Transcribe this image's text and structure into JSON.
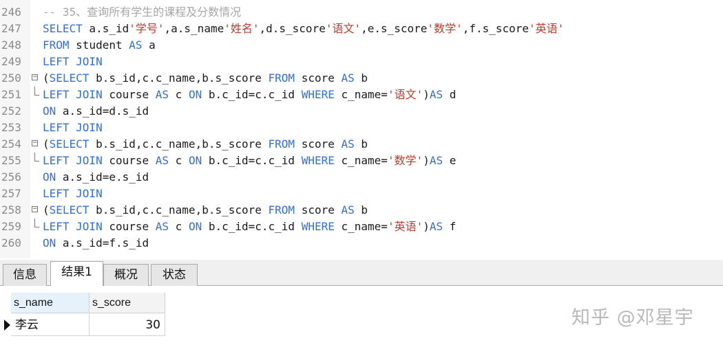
{
  "editor": {
    "lines": [
      {
        "num": "246",
        "fold": "",
        "segments": [
          {
            "t": "-- 35、查询所有学生的课程及分数情况",
            "c": "cmt"
          }
        ]
      },
      {
        "num": "247",
        "fold": "",
        "segments": [
          {
            "t": "SELECT",
            "c": "kw"
          },
          {
            "t": " a.s_id",
            "c": "txt"
          },
          {
            "t": "'学号'",
            "c": "str"
          },
          {
            "t": ",a.s_name",
            "c": "txt"
          },
          {
            "t": "'姓名'",
            "c": "str"
          },
          {
            "t": ",d.s_score",
            "c": "txt"
          },
          {
            "t": "'语文'",
            "c": "str"
          },
          {
            "t": ",e.s_score",
            "c": "txt"
          },
          {
            "t": "'数学'",
            "c": "str"
          },
          {
            "t": ",f.s_score",
            "c": "txt"
          },
          {
            "t": "'英语'",
            "c": "str"
          }
        ]
      },
      {
        "num": "248",
        "fold": "",
        "segments": [
          {
            "t": "FROM",
            "c": "kw"
          },
          {
            "t": " student ",
            "c": "txt"
          },
          {
            "t": "AS",
            "c": "kw"
          },
          {
            "t": " a",
            "c": "txt"
          }
        ]
      },
      {
        "num": "249",
        "fold": "",
        "segments": [
          {
            "t": "LEFT JOIN",
            "c": "kw"
          }
        ]
      },
      {
        "num": "250",
        "fold": "start",
        "segments": [
          {
            "t": "(",
            "c": "txt"
          },
          {
            "t": "SELECT",
            "c": "kw"
          },
          {
            "t": " b.s_id,c.c_name,b.s_score ",
            "c": "txt"
          },
          {
            "t": "FROM",
            "c": "kw"
          },
          {
            "t": " score ",
            "c": "txt"
          },
          {
            "t": "AS",
            "c": "kw"
          },
          {
            "t": " b",
            "c": "txt"
          }
        ]
      },
      {
        "num": "251",
        "fold": "end",
        "segments": [
          {
            "t": "LEFT JOIN",
            "c": "kw"
          },
          {
            "t": " course ",
            "c": "txt"
          },
          {
            "t": "AS",
            "c": "kw"
          },
          {
            "t": " c ",
            "c": "txt"
          },
          {
            "t": "ON",
            "c": "kw"
          },
          {
            "t": " b.c_id=c.c_id ",
            "c": "txt"
          },
          {
            "t": "WHERE",
            "c": "kw"
          },
          {
            "t": " c_name=",
            "c": "txt"
          },
          {
            "t": "'语文'",
            "c": "str"
          },
          {
            "t": ")",
            "c": "txt"
          },
          {
            "t": "AS",
            "c": "kw"
          },
          {
            "t": " d",
            "c": "txt"
          }
        ]
      },
      {
        "num": "252",
        "fold": "",
        "segments": [
          {
            "t": "ON",
            "c": "kw"
          },
          {
            "t": " a.s_id=d.s_id",
            "c": "txt"
          }
        ]
      },
      {
        "num": "253",
        "fold": "",
        "segments": [
          {
            "t": "LEFT JOIN",
            "c": "kw"
          }
        ]
      },
      {
        "num": "254",
        "fold": "start",
        "segments": [
          {
            "t": "(",
            "c": "txt"
          },
          {
            "t": "SELECT",
            "c": "kw"
          },
          {
            "t": " b.s_id,c.c_name,b.s_score ",
            "c": "txt"
          },
          {
            "t": "FROM",
            "c": "kw"
          },
          {
            "t": " score ",
            "c": "txt"
          },
          {
            "t": "AS",
            "c": "kw"
          },
          {
            "t": " b",
            "c": "txt"
          }
        ]
      },
      {
        "num": "255",
        "fold": "end",
        "segments": [
          {
            "t": "LEFT JOIN",
            "c": "kw"
          },
          {
            "t": " course ",
            "c": "txt"
          },
          {
            "t": "AS",
            "c": "kw"
          },
          {
            "t": " c ",
            "c": "txt"
          },
          {
            "t": "ON",
            "c": "kw"
          },
          {
            "t": " b.c_id=c.c_id ",
            "c": "txt"
          },
          {
            "t": "WHERE",
            "c": "kw"
          },
          {
            "t": " c_name=",
            "c": "txt"
          },
          {
            "t": "'数学'",
            "c": "str"
          },
          {
            "t": ")",
            "c": "txt"
          },
          {
            "t": "AS",
            "c": "kw"
          },
          {
            "t": " e",
            "c": "txt"
          }
        ]
      },
      {
        "num": "256",
        "fold": "",
        "segments": [
          {
            "t": "ON",
            "c": "kw"
          },
          {
            "t": " a.s_id=e.s_id",
            "c": "txt"
          }
        ]
      },
      {
        "num": "257",
        "fold": "",
        "segments": [
          {
            "t": "LEFT JOIN",
            "c": "kw"
          }
        ]
      },
      {
        "num": "258",
        "fold": "start",
        "segments": [
          {
            "t": "(",
            "c": "txt"
          },
          {
            "t": "SELECT",
            "c": "kw"
          },
          {
            "t": " b.s_id,c.c_name,b.s_score ",
            "c": "txt"
          },
          {
            "t": "FROM",
            "c": "kw"
          },
          {
            "t": " score ",
            "c": "txt"
          },
          {
            "t": "AS",
            "c": "kw"
          },
          {
            "t": " b",
            "c": "txt"
          }
        ]
      },
      {
        "num": "259",
        "fold": "end",
        "segments": [
          {
            "t": "LEFT JOIN",
            "c": "kw"
          },
          {
            "t": " course ",
            "c": "txt"
          },
          {
            "t": "AS",
            "c": "kw"
          },
          {
            "t": " c ",
            "c": "txt"
          },
          {
            "t": "ON",
            "c": "kw"
          },
          {
            "t": " b.c_id=c.c_id ",
            "c": "txt"
          },
          {
            "t": "WHERE",
            "c": "kw"
          },
          {
            "t": " c_name=",
            "c": "txt"
          },
          {
            "t": "'英语'",
            "c": "str"
          },
          {
            "t": ")",
            "c": "txt"
          },
          {
            "t": "AS",
            "c": "kw"
          },
          {
            "t": " f",
            "c": "txt"
          }
        ]
      },
      {
        "num": "260",
        "fold": "",
        "segments": [
          {
            "t": "ON",
            "c": "kw"
          },
          {
            "t": " a.s_id=f.s_id",
            "c": "txt"
          }
        ]
      }
    ]
  },
  "tabs": [
    {
      "label": "信息",
      "active": false
    },
    {
      "label": "结果1",
      "active": true
    },
    {
      "label": "概况",
      "active": false
    },
    {
      "label": "状态",
      "active": false
    }
  ],
  "result": {
    "columns": [
      "s_name",
      "s_score"
    ],
    "rows": [
      [
        "李云",
        "30"
      ]
    ]
  },
  "watermark": "知乎 @邓星宇",
  "colors": {
    "keyword": "#2f6fe0",
    "string": "#c0392b",
    "comment": "#a6a6a6",
    "header_bg": "#e6f2fb"
  }
}
